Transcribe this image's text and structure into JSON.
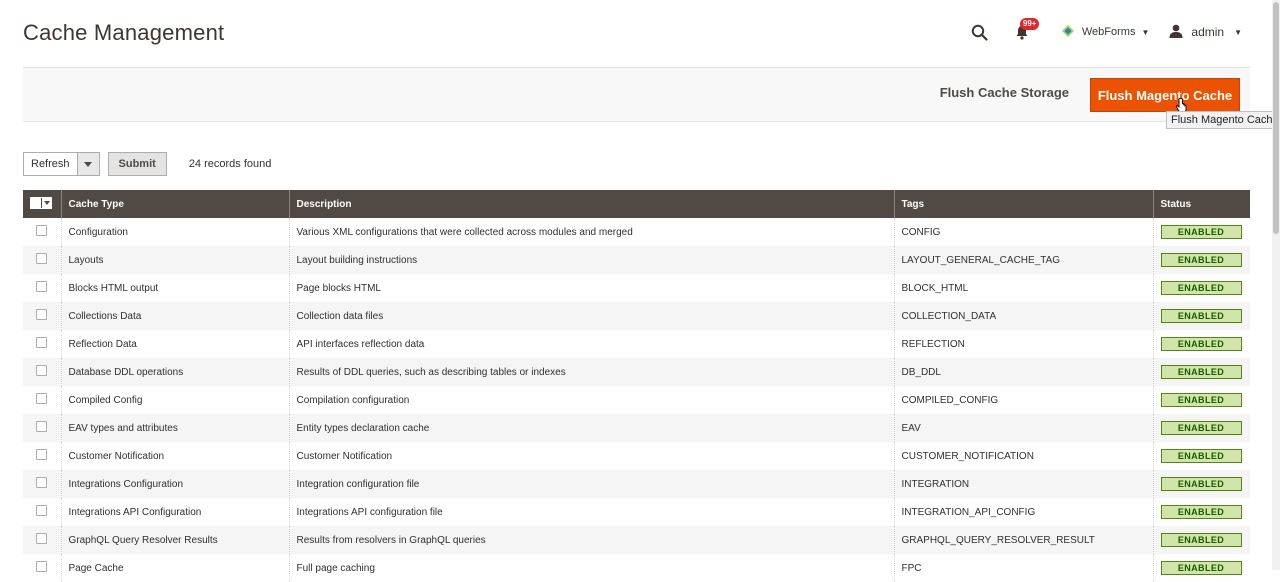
{
  "page": {
    "title": "Cache Management"
  },
  "header": {
    "search_icon": "search-icon",
    "notifications": {
      "icon": "bell-icon",
      "count": "99+"
    },
    "webforms": {
      "label": "WebForms",
      "icon": "webforms-logo-icon"
    },
    "user": {
      "label": "admin",
      "icon": "user-icon"
    }
  },
  "actions": {
    "flush_storage_label": "Flush Cache Storage",
    "flush_magento_label": "Flush Magento Cache",
    "tooltip": "Flush Magento Cache"
  },
  "controls": {
    "mass_action_value": "Refresh",
    "submit_label": "Submit",
    "records_found": "24 records found"
  },
  "grid": {
    "columns": [
      "Cache Type",
      "Description",
      "Tags",
      "Status"
    ],
    "rows": [
      {
        "type": "Configuration",
        "description": "Various XML configurations that were collected across modules and merged",
        "tags": "CONFIG",
        "status": "ENABLED"
      },
      {
        "type": "Layouts",
        "description": "Layout building instructions",
        "tags": "LAYOUT_GENERAL_CACHE_TAG",
        "status": "ENABLED"
      },
      {
        "type": "Blocks HTML output",
        "description": "Page blocks HTML",
        "tags": "BLOCK_HTML",
        "status": "ENABLED"
      },
      {
        "type": "Collections Data",
        "description": "Collection data files",
        "tags": "COLLECTION_DATA",
        "status": "ENABLED"
      },
      {
        "type": "Reflection Data",
        "description": "API interfaces reflection data",
        "tags": "REFLECTION",
        "status": "ENABLED"
      },
      {
        "type": "Database DDL operations",
        "description": "Results of DDL queries, such as describing tables or indexes",
        "tags": "DB_DDL",
        "status": "ENABLED"
      },
      {
        "type": "Compiled Config",
        "description": "Compilation configuration",
        "tags": "COMPILED_CONFIG",
        "status": "ENABLED"
      },
      {
        "type": "EAV types and attributes",
        "description": "Entity types declaration cache",
        "tags": "EAV",
        "status": "ENABLED"
      },
      {
        "type": "Customer Notification",
        "description": "Customer Notification",
        "tags": "CUSTOMER_NOTIFICATION",
        "status": "ENABLED"
      },
      {
        "type": "Integrations Configuration",
        "description": "Integration configuration file",
        "tags": "INTEGRATION",
        "status": "ENABLED"
      },
      {
        "type": "Integrations API Configuration",
        "description": "Integrations API configuration file",
        "tags": "INTEGRATION_API_CONFIG",
        "status": "ENABLED"
      },
      {
        "type": "GraphQL Query Resolver Results",
        "description": "Results from resolvers in GraphQL queries",
        "tags": "GRAPHQL_QUERY_RESOLVER_RESULT",
        "status": "ENABLED"
      },
      {
        "type": "Page Cache",
        "description": "Full page caching",
        "tags": "FPC",
        "status": "ENABLED"
      }
    ]
  },
  "colors": {
    "primary_button": "#eb5202",
    "table_header": "#514943",
    "status_enabled_bg": "#d0e5a9",
    "status_enabled_border": "#5b8116"
  }
}
